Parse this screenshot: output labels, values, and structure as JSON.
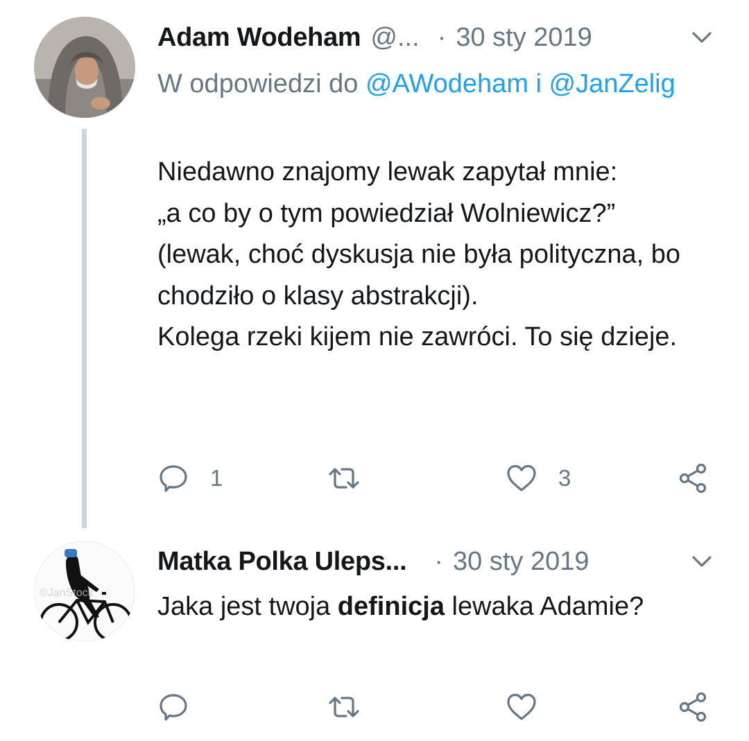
{
  "tweets": [
    {
      "author_name": "Adam Wodeham",
      "handle": "@...",
      "separator": "·",
      "date": "30 sty 2019",
      "reply_to": {
        "prefix": "W odpowiedzi do",
        "users": "@AWodeham i @JanZelig"
      },
      "body": "Niedawno znajomy lewak zapytał mnie:\n„a co by o tym powiedział Wolniewicz?”\n(lewak, choć dyskusja nie była polityczna, bo chodziło o klasy abstrakcji).\nKolega rzeki kijem nie zawróci. To się dzieje.",
      "actions": {
        "reply_count": "1",
        "retweet_count": "",
        "like_count": "3"
      }
    },
    {
      "author_name": "Matka Polka Uleps...",
      "handle": "",
      "separator": "·",
      "date": "30 sty 2019",
      "body_before": "Jaka jest twoja ",
      "body_bold": "definicja",
      "body_after": " lewaka Adamie?",
      "actions": {
        "reply_count": "",
        "retweet_count": "",
        "like_count": ""
      }
    }
  ],
  "icons": {
    "reply": "reply-icon",
    "retweet": "retweet-icon",
    "like": "heart-icon",
    "share": "share-icon",
    "menu": "chevron-down-icon"
  },
  "colors": {
    "text": "#14171a",
    "secondary": "#657786",
    "link": "#1da1f2",
    "thread_line": "#ccd6dd"
  }
}
